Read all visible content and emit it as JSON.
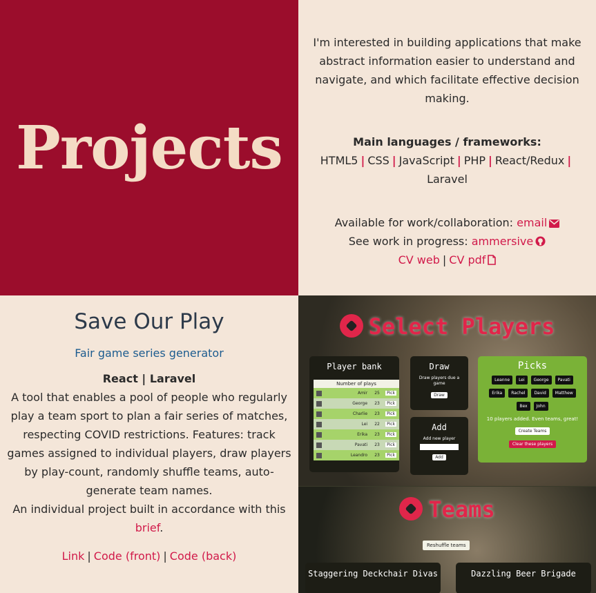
{
  "hero": {
    "title": "Projects"
  },
  "intro": {
    "blurb": "I'm interested in building applications that make abstract information easier to understand and navigate, and which facilitate effective decision making.",
    "languages_heading": "Main languages / frameworks:",
    "languages": [
      "HTML5",
      "CSS",
      "JavaScript",
      "PHP",
      "React/Redux",
      "Laravel"
    ],
    "available_text": "Available for work/collaboration:",
    "email_label": "email",
    "wip_text": "See work in progress:",
    "github_label": "ammersive",
    "cv_web_label": "CV web",
    "cv_pdf_label": "CV pdf",
    "separator": "|",
    "icons": {
      "email": "envelope-icon",
      "github": "github-icon",
      "pdf": "file-icon"
    }
  },
  "project": {
    "title": "Save Our Play",
    "subtitle": "Fair game series generator",
    "stack": "React | Laravel",
    "description": "A tool that enables a pool of people who regularly play a team sport to plan a fair series of matches, respecting COVID restrictions. Features: track games assigned to individual players, draw players by play-count, randomly shuffle teams, auto-generate team names.",
    "brief_prefix": "An individual project built in accordance with this",
    "brief_label": "brief",
    "brief_suffix": ".",
    "link_label": "Link",
    "code_front_label": "Code (front)",
    "code_back_label": "Code (back)"
  },
  "screenshot": {
    "select_title": "Select Players",
    "player_bank": {
      "heading": "Player bank",
      "column_label": "Number of plays",
      "pick_label": "Pick",
      "players": [
        {
          "name": "Amir",
          "plays": "25"
        },
        {
          "name": "George",
          "plays": "23"
        },
        {
          "name": "Charlie",
          "plays": "23"
        },
        {
          "name": "Lei",
          "plays": "22"
        },
        {
          "name": "Erika",
          "plays": "23"
        },
        {
          "name": "Pavati",
          "plays": "23"
        },
        {
          "name": "Leandro",
          "plays": "23"
        }
      ]
    },
    "draw": {
      "heading": "Draw",
      "text": "Draw players due a game",
      "button": "Draw"
    },
    "add": {
      "heading": "Add",
      "label": "Add new player",
      "button": "Add"
    },
    "picks": {
      "heading": "Picks",
      "names": [
        "Leanne",
        "Lei",
        "George",
        "Pavati",
        "Erika",
        "Rachel",
        "David",
        "Matthew",
        "Bex",
        "John"
      ],
      "message": "10 players added. Even teams, great!",
      "create_button": "Create Teams",
      "clear_button": "Clear these players"
    },
    "teams_title": "Teams",
    "reshuffle_button": "Reshuffle teams",
    "team_names": [
      "Staggering Deckchair Divas",
      "Dazzling Beer Brigade"
    ]
  }
}
